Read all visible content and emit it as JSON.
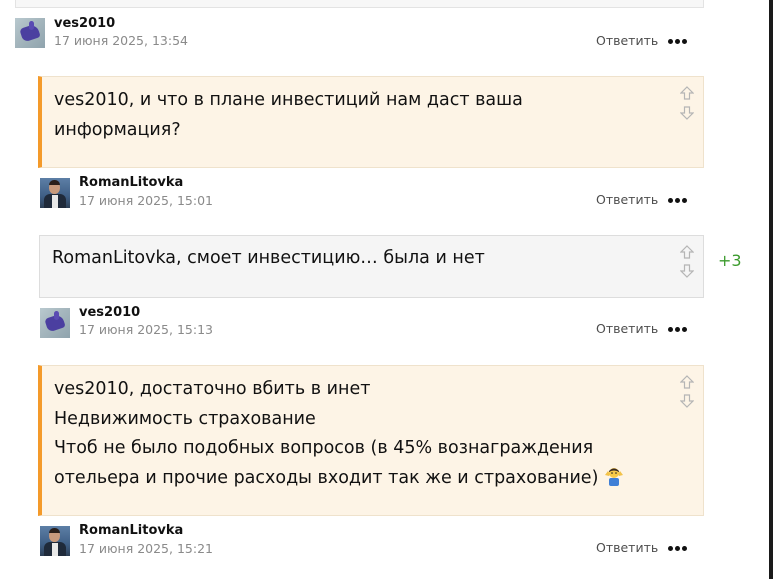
{
  "comments": [
    {
      "author": "ves2010",
      "date": "17 июня 2025, 13:54",
      "reply": "Ответить",
      "avatar": "hand-avatar"
    },
    {
      "author": "RomanLitovka",
      "date": "17 июня 2025, 15:01",
      "reply": "Ответить",
      "avatar": "person-avatar",
      "quote_lines": [
        "ves2010, и что в плане инвестиций нам даст ваша",
        "информация?"
      ]
    },
    {
      "author": "ves2010",
      "date": "17 июня 2025, 15:13",
      "reply": "Ответить",
      "avatar": "hand-avatar",
      "text_lines": [
        "RomanLitovka, смоет инвестицию… была и нет"
      ],
      "score": "+3"
    },
    {
      "author": "RomanLitovka",
      "date": "17 июня 2025, 15:21",
      "reply": "Ответить",
      "avatar": "person-avatar",
      "quote_lines": [
        "ves2010, достаточно вбить в инет",
        "Недвижимость страхование",
        "Чтоб не было подобных вопросов (в 45% вознаграждения",
        "отельера и прочие расходы входит так же и страхование)"
      ],
      "emoji": "person-shrugging-emoji"
    }
  ],
  "colors": {
    "accent_orange": "#f49a2a",
    "quote_bg": "#fdf4e6",
    "plain_bg": "#f5f5f5",
    "score_green": "#3c9b2d",
    "muted_text": "#8a8a8a"
  },
  "icons": {
    "vote_up": "arrow-up-outline-icon",
    "vote_down": "arrow-down-outline-icon",
    "more": "ellipsis-icon"
  }
}
